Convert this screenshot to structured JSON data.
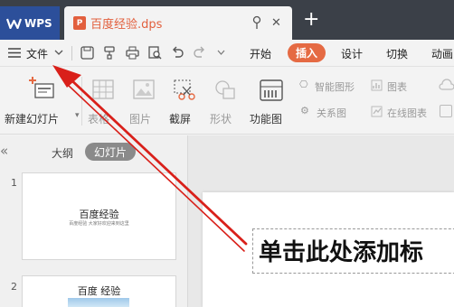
{
  "tabs": {
    "app_label": "WPS",
    "doc_title": "百度经验.dps",
    "doc_icon_letter": "P"
  },
  "menu": {
    "file_label": "文件",
    "tabs": [
      "开始",
      "插入",
      "设计",
      "切换",
      "动画"
    ],
    "active_tab": "插入"
  },
  "ribbon": {
    "new_slide_label": "新建幻灯片",
    "table_label": "表格",
    "picture_label": "图片",
    "screenshot_label": "截屏",
    "shape_label": "形状",
    "function_chart_label": "功能图",
    "smartart_label": "智能图形",
    "chart_label": "图表",
    "relation_label": "关系图",
    "online_chart_label": "在线图表",
    "dropdown_glyph": "▾"
  },
  "sidebar": {
    "collapse_glyph": "«",
    "tab_outline": "大纲",
    "tab_slides": "幻灯片",
    "slides": [
      {
        "number": "1",
        "title": "百度经验",
        "subtitle": "百度经验 大家好欢迎来到这里"
      },
      {
        "number": "2",
        "title": "百度 经验"
      }
    ]
  },
  "slide": {
    "title_placeholder": "单击此处添加标"
  },
  "colors": {
    "accent": "#e56a43",
    "wps_blue": "#2c4f9a",
    "arrow": "#d9201a"
  }
}
